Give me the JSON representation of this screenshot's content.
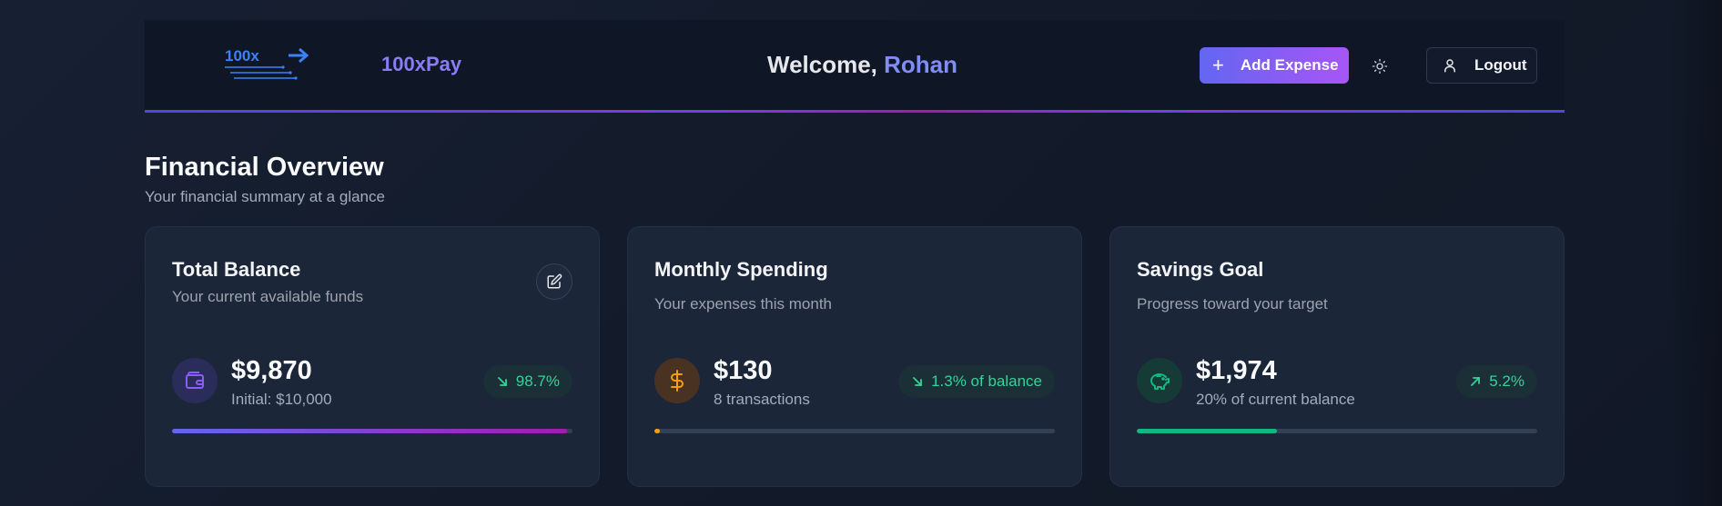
{
  "header": {
    "logo_text": "100x",
    "brand_name": "100xPay",
    "welcome_prefix": "Welcome, ",
    "user_name": "Rohan",
    "add_expense_label": "Add Expense",
    "logout_label": "Logout"
  },
  "overview": {
    "title": "Financial Overview",
    "subtitle": "Your financial summary at a glance"
  },
  "cards": [
    {
      "title": "Total Balance",
      "subtitle": "Your current available funds",
      "amount": "$9,870",
      "detail": "Initial: $10,000",
      "badge": "98.7%",
      "badge_direction": "down-right",
      "progress": 0.987,
      "icon": "wallet-icon",
      "accent": "#8b5cf6"
    },
    {
      "title": "Monthly Spending",
      "subtitle": "Your expenses this month",
      "amount": "$130",
      "detail": "8 transactions",
      "badge": "1.3% of balance",
      "badge_direction": "down-right",
      "progress": 0.013,
      "icon": "dollar-icon",
      "accent": "#f59e0b"
    },
    {
      "title": "Savings Goal",
      "subtitle": "Progress toward your target",
      "amount": "$1,974",
      "detail": "20% of current balance",
      "badge": "5.2%",
      "badge_direction": "up-right",
      "progress": 0.35,
      "icon": "piggy-bank-icon",
      "accent": "#10b981"
    }
  ],
  "colors": {
    "primary": "#6366f1",
    "gradient_end": "#a855f7",
    "positive": "#34d399",
    "background": "#141c2b",
    "card": "#1c2639"
  }
}
